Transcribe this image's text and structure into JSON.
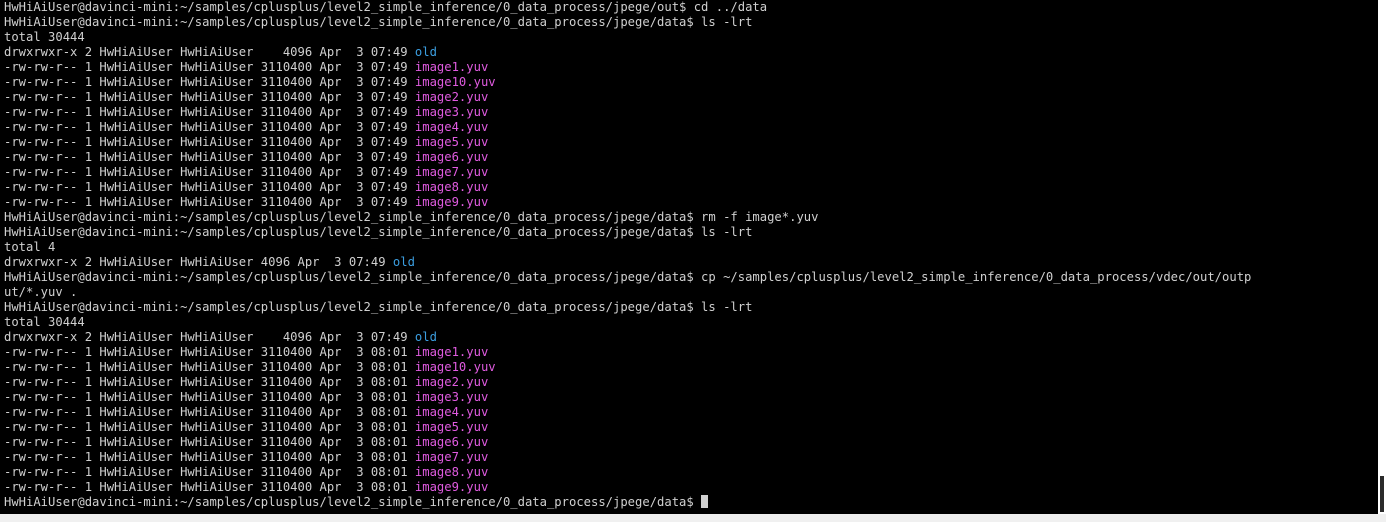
{
  "terminal": {
    "colors": {
      "background": "#000000",
      "text": "#d0d0d0",
      "directory": "#3b9ee0",
      "yuv_file": "#e05be0"
    },
    "lines": [
      [
        {
          "t": "HwHiAiUser@davinci-mini:~/samples/cplusplus/level2_simple_inference/0_data_process/jpege/out$ cd ../data"
        }
      ],
      [
        {
          "t": "HwHiAiUser@davinci-mini:~/samples/cplusplus/level2_simple_inference/0_data_process/jpege/data$ ls -lrt"
        }
      ],
      [
        {
          "t": "total 30444"
        }
      ],
      [
        {
          "t": "drwxrwxr-x 2 HwHiAiUser HwHiAiUser    4096 Apr  3 07:49 "
        },
        {
          "t": "old",
          "c": "dir"
        }
      ],
      [
        {
          "t": "-rw-rw-r-- 1 HwHiAiUser HwHiAiUser 3110400 Apr  3 07:49 "
        },
        {
          "t": "image1.yuv",
          "c": "file"
        }
      ],
      [
        {
          "t": "-rw-rw-r-- 1 HwHiAiUser HwHiAiUser 3110400 Apr  3 07:49 "
        },
        {
          "t": "image10.yuv",
          "c": "file"
        }
      ],
      [
        {
          "t": "-rw-rw-r-- 1 HwHiAiUser HwHiAiUser 3110400 Apr  3 07:49 "
        },
        {
          "t": "image2.yuv",
          "c": "file"
        }
      ],
      [
        {
          "t": "-rw-rw-r-- 1 HwHiAiUser HwHiAiUser 3110400 Apr  3 07:49 "
        },
        {
          "t": "image3.yuv",
          "c": "file"
        }
      ],
      [
        {
          "t": "-rw-rw-r-- 1 HwHiAiUser HwHiAiUser 3110400 Apr  3 07:49 "
        },
        {
          "t": "image4.yuv",
          "c": "file"
        }
      ],
      [
        {
          "t": "-rw-rw-r-- 1 HwHiAiUser HwHiAiUser 3110400 Apr  3 07:49 "
        },
        {
          "t": "image5.yuv",
          "c": "file"
        }
      ],
      [
        {
          "t": "-rw-rw-r-- 1 HwHiAiUser HwHiAiUser 3110400 Apr  3 07:49 "
        },
        {
          "t": "image6.yuv",
          "c": "file"
        }
      ],
      [
        {
          "t": "-rw-rw-r-- 1 HwHiAiUser HwHiAiUser 3110400 Apr  3 07:49 "
        },
        {
          "t": "image7.yuv",
          "c": "file"
        }
      ],
      [
        {
          "t": "-rw-rw-r-- 1 HwHiAiUser HwHiAiUser 3110400 Apr  3 07:49 "
        },
        {
          "t": "image8.yuv",
          "c": "file"
        }
      ],
      [
        {
          "t": "-rw-rw-r-- 1 HwHiAiUser HwHiAiUser 3110400 Apr  3 07:49 "
        },
        {
          "t": "image9.yuv",
          "c": "file"
        }
      ],
      [
        {
          "t": "HwHiAiUser@davinci-mini:~/samples/cplusplus/level2_simple_inference/0_data_process/jpege/data$ rm -f image*.yuv"
        }
      ],
      [
        {
          "t": "HwHiAiUser@davinci-mini:~/samples/cplusplus/level2_simple_inference/0_data_process/jpege/data$ ls -lrt"
        }
      ],
      [
        {
          "t": "total 4"
        }
      ],
      [
        {
          "t": "drwxrwxr-x 2 HwHiAiUser HwHiAiUser 4096 Apr  3 07:49 "
        },
        {
          "t": "old",
          "c": "dir"
        }
      ],
      [
        {
          "t": "HwHiAiUser@davinci-mini:~/samples/cplusplus/level2_simple_inference/0_data_process/jpege/data$ cp ~/samples/cplusplus/level2_simple_inference/0_data_process/vdec/out/outp"
        }
      ],
      [
        {
          "t": "ut/*.yuv ."
        }
      ],
      [
        {
          "t": "HwHiAiUser@davinci-mini:~/samples/cplusplus/level2_simple_inference/0_data_process/jpege/data$ ls -lrt"
        }
      ],
      [
        {
          "t": "total 30444"
        }
      ],
      [
        {
          "t": "drwxrwxr-x 2 HwHiAiUser HwHiAiUser    4096 Apr  3 07:49 "
        },
        {
          "t": "old",
          "c": "dir"
        }
      ],
      [
        {
          "t": "-rw-rw-r-- 1 HwHiAiUser HwHiAiUser 3110400 Apr  3 08:01 "
        },
        {
          "t": "image1.yuv",
          "c": "file"
        }
      ],
      [
        {
          "t": "-rw-rw-r-- 1 HwHiAiUser HwHiAiUser 3110400 Apr  3 08:01 "
        },
        {
          "t": "image10.yuv",
          "c": "file"
        }
      ],
      [
        {
          "t": "-rw-rw-r-- 1 HwHiAiUser HwHiAiUser 3110400 Apr  3 08:01 "
        },
        {
          "t": "image2.yuv",
          "c": "file"
        }
      ],
      [
        {
          "t": "-rw-rw-r-- 1 HwHiAiUser HwHiAiUser 3110400 Apr  3 08:01 "
        },
        {
          "t": "image3.yuv",
          "c": "file"
        }
      ],
      [
        {
          "t": "-rw-rw-r-- 1 HwHiAiUser HwHiAiUser 3110400 Apr  3 08:01 "
        },
        {
          "t": "image4.yuv",
          "c": "file"
        }
      ],
      [
        {
          "t": "-rw-rw-r-- 1 HwHiAiUser HwHiAiUser 3110400 Apr  3 08:01 "
        },
        {
          "t": "image5.yuv",
          "c": "file"
        }
      ],
      [
        {
          "t": "-rw-rw-r-- 1 HwHiAiUser HwHiAiUser 3110400 Apr  3 08:01 "
        },
        {
          "t": "image6.yuv",
          "c": "file"
        }
      ],
      [
        {
          "t": "-rw-rw-r-- 1 HwHiAiUser HwHiAiUser 3110400 Apr  3 08:01 "
        },
        {
          "t": "image7.yuv",
          "c": "file"
        }
      ],
      [
        {
          "t": "-rw-rw-r-- 1 HwHiAiUser HwHiAiUser 3110400 Apr  3 08:01 "
        },
        {
          "t": "image8.yuv",
          "c": "file"
        }
      ],
      [
        {
          "t": "-rw-rw-r-- 1 HwHiAiUser HwHiAiUser 3110400 Apr  3 08:01 "
        },
        {
          "t": "image9.yuv",
          "c": "file"
        }
      ]
    ],
    "prompt": "HwHiAiUser@davinci-mini:~/samples/cplusplus/level2_simple_inference/0_data_process/jpege/data$ "
  }
}
